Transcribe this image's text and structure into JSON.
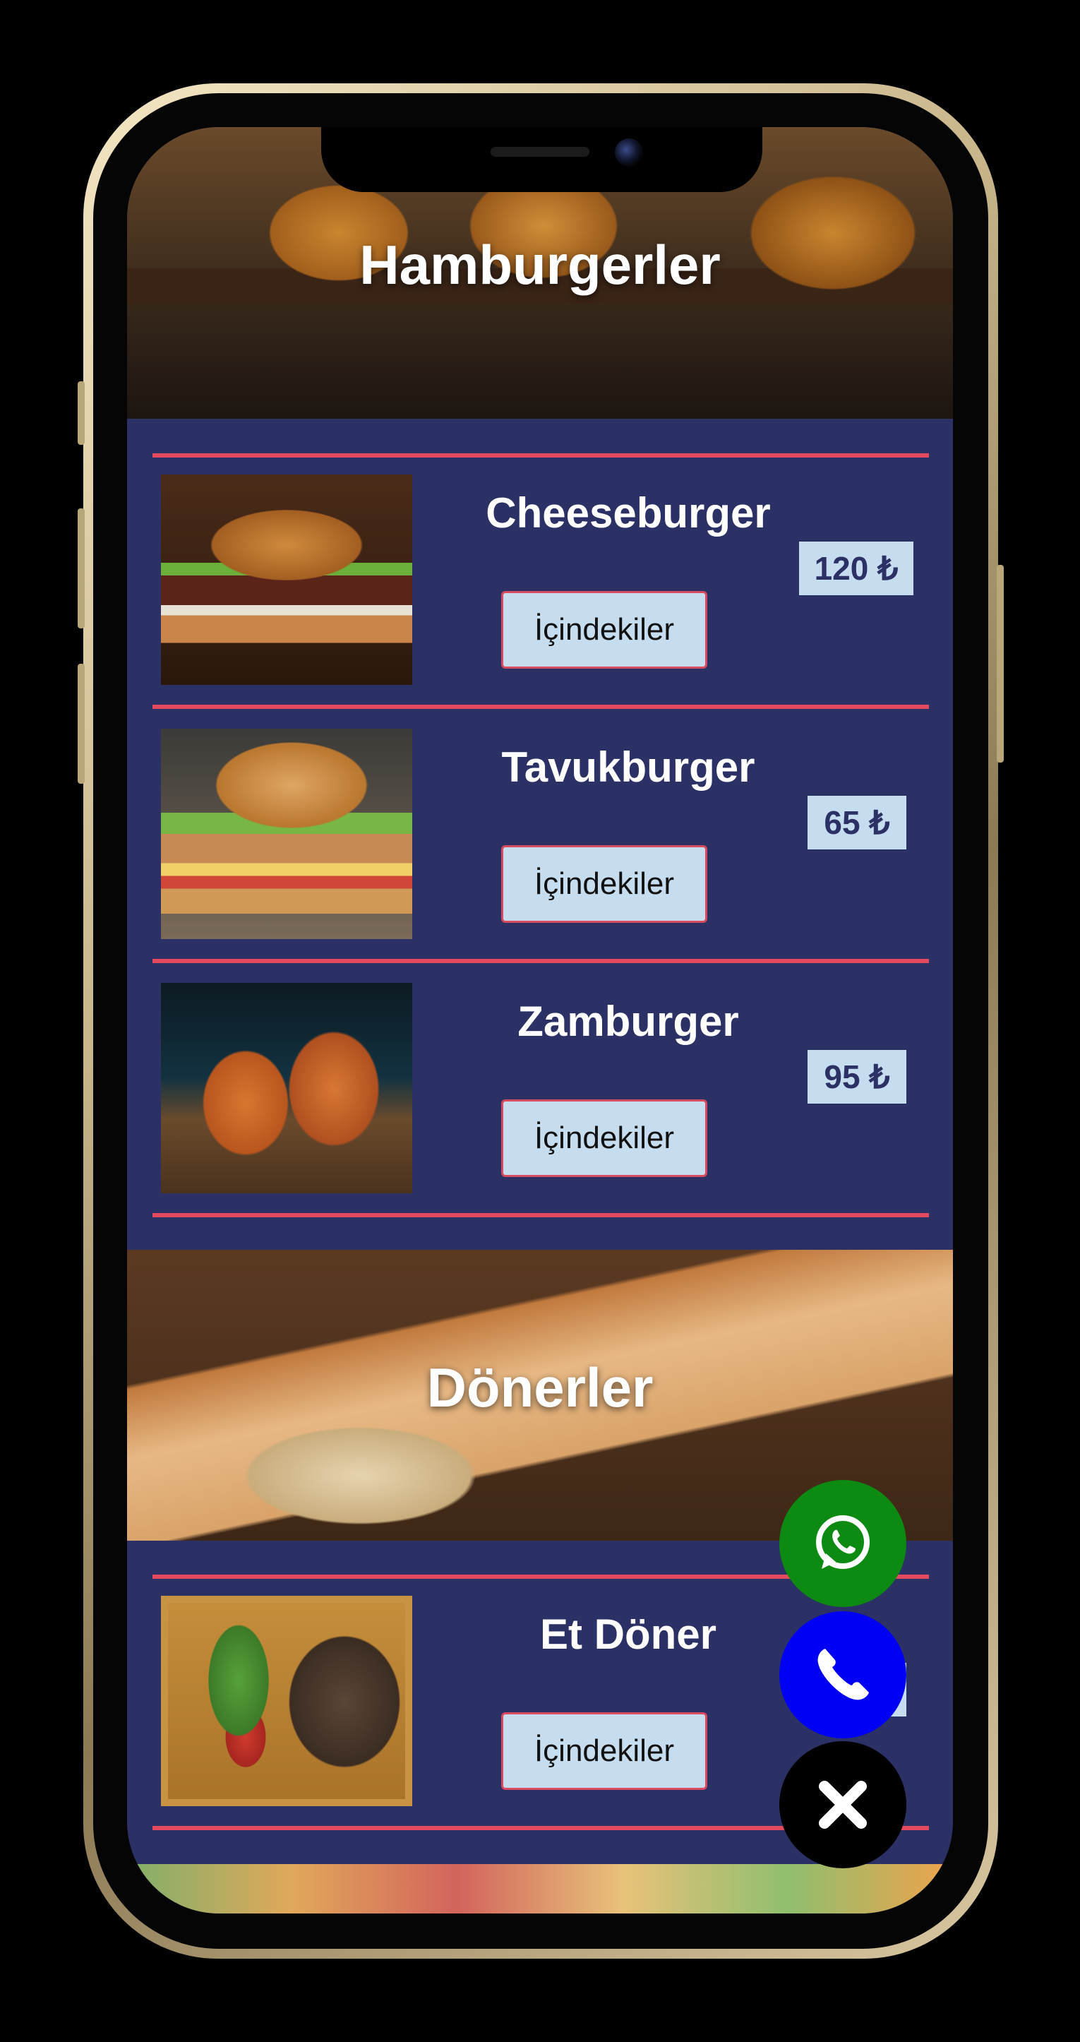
{
  "categories": [
    {
      "title": "Hamburgerler",
      "items": [
        {
          "name": "Cheeseburger",
          "price": "120 ₺",
          "details_label": "İçindekiler"
        },
        {
          "name": "Tavukburger",
          "price": "65 ₺",
          "details_label": "İçindekiler"
        },
        {
          "name": "Zamburger",
          "price": "95 ₺",
          "details_label": "İçindekiler"
        }
      ]
    },
    {
      "title": "Dönerler",
      "items": [
        {
          "name": "Et Döner",
          "price": "",
          "details_label": "İçindekiler"
        }
      ]
    }
  ],
  "colors": {
    "background": "#2b3065",
    "separator": "#e34a5d",
    "button_bg": "#c6dcef",
    "whatsapp": "#0c8a12",
    "phone": "#0000f5",
    "close": "#000000"
  },
  "fab": {
    "whatsapp_icon": "whatsapp-icon",
    "phone_icon": "phone-icon",
    "close_icon": "close-icon"
  }
}
